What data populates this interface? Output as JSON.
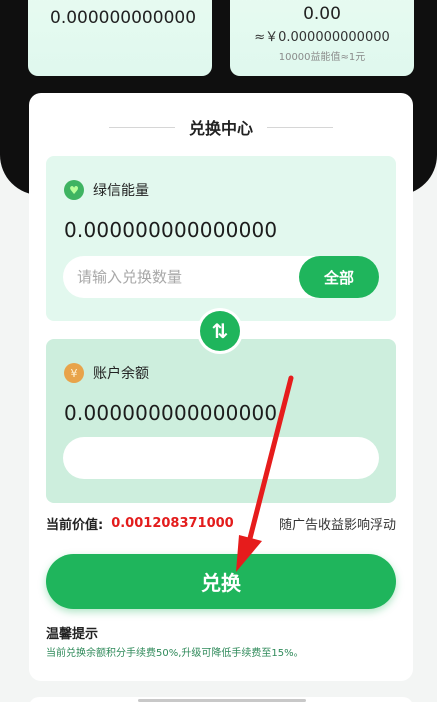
{
  "top_left": {
    "value": "0.000000000000"
  },
  "top_right": {
    "value": "0.00",
    "approx": "≈￥0.000000000000",
    "note": "10000益能值≈1元"
  },
  "exchange_center": {
    "title": "兑换中心",
    "source": {
      "label": "绿信能量",
      "amount": "0.000000000000000",
      "placeholder": "请输入兑换数量",
      "all_label": "全部",
      "icon": "heart-coin-icon"
    },
    "swap_icon_text": "⇅",
    "target": {
      "label": "账户余额",
      "amount": "0.000000000000000",
      "value": "",
      "icon": "yen-coin-icon"
    },
    "price_label": "当前价值:",
    "price_value": "0.001208371000",
    "price_note": "随广告收益影响浮动",
    "exchange_label": "兑换",
    "tips_title": "温馨提示",
    "tips_text": "当前兑换余额积分手续费50%,升级可降低手续费至15%。"
  },
  "colors": {
    "accent": "#1fb55c",
    "price": "#e31c1c",
    "arrow": "#e61c1c"
  }
}
